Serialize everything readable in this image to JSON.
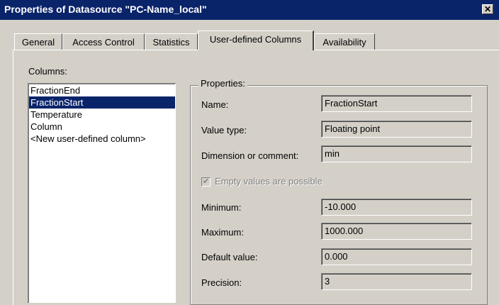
{
  "window": {
    "title": "Properties of Datasource \"PC-Name_local\"",
    "close_icon": "close-icon"
  },
  "tabs": [
    {
      "label": "General",
      "active": false
    },
    {
      "label": "Access Control",
      "active": false
    },
    {
      "label": "Statistics",
      "active": false
    },
    {
      "label": "User-defined Columns",
      "active": true
    },
    {
      "label": "Availability",
      "active": false
    }
  ],
  "columns": {
    "label": "Columns:",
    "items": [
      "FractionEnd",
      "FractionStart",
      "Temperature",
      "Column",
      "<New user-defined column>"
    ],
    "selected": "FractionStart"
  },
  "properties": {
    "group_title": "Properties:",
    "name": {
      "label": "Name:",
      "value": "FractionStart"
    },
    "value_type": {
      "label": "Value type:",
      "value": "Floating point"
    },
    "dimension": {
      "label": "Dimension or comment:",
      "value": "min"
    },
    "empty_values": {
      "label": "Empty values are possible",
      "checked": true,
      "enabled": false
    },
    "minimum": {
      "label": "Minimum:",
      "value": "-10.000"
    },
    "maximum": {
      "label": "Maximum:",
      "value": "1000.000"
    },
    "default_value": {
      "label": "Default value:",
      "value": "0.000"
    },
    "precision": {
      "label": "Precision:",
      "value": "3"
    }
  },
  "colors": {
    "titlebar": "#0a246a",
    "face": "#d4d0c8",
    "selection": "#0a246a"
  }
}
